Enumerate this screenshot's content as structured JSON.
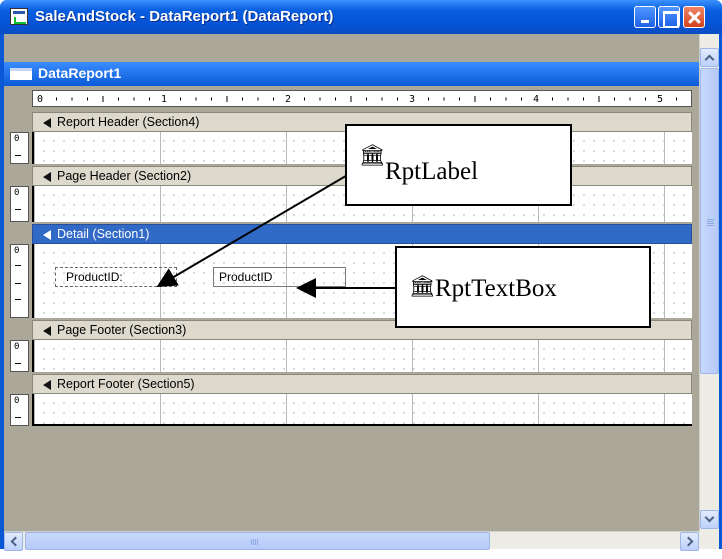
{
  "window": {
    "title": "SaleAndStock - DataReport1 (DataReport)"
  },
  "document": {
    "title": "DataReport1"
  },
  "ruler": {
    "inch_labels": [
      "0",
      "1",
      "2",
      "3",
      "4",
      "5"
    ]
  },
  "vruler": {
    "zero_label": "0"
  },
  "sections": [
    {
      "label": "Report Header (Section4)",
      "active": false
    },
    {
      "label": "Page Header (Section2)",
      "active": false
    },
    {
      "label": "Detail (Section1)",
      "active": true
    },
    {
      "label": "Page Footer (Section3)",
      "active": false
    },
    {
      "label": "Report Footer (Section5)",
      "active": false
    }
  ],
  "controls": {
    "label_text": "ProductID:",
    "textbox_text": "ProductID"
  },
  "callouts": {
    "rptlabel": {
      "icon": "rptlabel-toolbox-icon",
      "text": "RptLabel"
    },
    "rpttextbox": {
      "icon": "rpttextbox-toolbox-icon",
      "text": "RptTextBox"
    }
  },
  "colors": {
    "title_bar": "#0a58d6",
    "active_section": "#3169c6",
    "canvas": "#aca899"
  }
}
